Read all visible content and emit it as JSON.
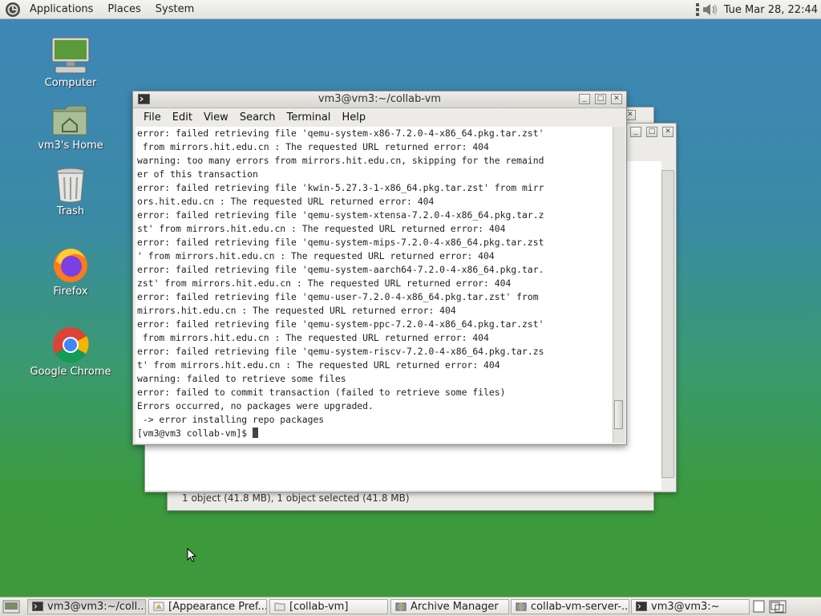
{
  "top_panel": {
    "menus": [
      "Applications",
      "Places",
      "System"
    ],
    "clock": "Tue Mar 28, 22:44"
  },
  "desktop_icons": [
    {
      "label": "Computer",
      "icon": "computer-icon"
    },
    {
      "label": "vm3's Home",
      "icon": "home-folder-icon"
    },
    {
      "label": "Trash",
      "icon": "trash-icon"
    },
    {
      "label": "Firefox",
      "icon": "firefox-icon"
    },
    {
      "label": "Google Chrome",
      "icon": "chrome-icon"
    }
  ],
  "archive_manager": {
    "status": "1 object (41.8 MB), 1 object selected (41.8 MB)"
  },
  "terminal": {
    "title": "vm3@vm3:~/collab-vm",
    "menus": [
      "File",
      "Edit",
      "View",
      "Search",
      "Terminal",
      "Help"
    ],
    "lines": [
      "error: failed retrieving file 'qemu-system-x86-7.2.0-4-x86_64.pkg.tar.zst'",
      " from mirrors.hit.edu.cn : The requested URL returned error: 404",
      "warning: too many errors from mirrors.hit.edu.cn, skipping for the remaind",
      "er of this transaction",
      "error: failed retrieving file 'kwin-5.27.3-1-x86_64.pkg.tar.zst' from mirr",
      "ors.hit.edu.cn : The requested URL returned error: 404",
      "error: failed retrieving file 'qemu-system-xtensa-7.2.0-4-x86_64.pkg.tar.z",
      "st' from mirrors.hit.edu.cn : The requested URL returned error: 404",
      "error: failed retrieving file 'qemu-system-mips-7.2.0-4-x86_64.pkg.tar.zst",
      "' from mirrors.hit.edu.cn : The requested URL returned error: 404",
      "error: failed retrieving file 'qemu-system-aarch64-7.2.0-4-x86_64.pkg.tar.",
      "zst' from mirrors.hit.edu.cn : The requested URL returned error: 404",
      "error: failed retrieving file 'qemu-user-7.2.0-4-x86_64.pkg.tar.zst' from",
      "mirrors.hit.edu.cn : The requested URL returned error: 404",
      "error: failed retrieving file 'qemu-system-ppc-7.2.0-4-x86_64.pkg.tar.zst'",
      " from mirrors.hit.edu.cn : The requested URL returned error: 404",
      "error: failed retrieving file 'qemu-system-riscv-7.2.0-4-x86_64.pkg.tar.zs",
      "t' from mirrors.hit.edu.cn : The requested URL returned error: 404",
      "warning: failed to retrieve some files",
      "error: failed to commit transaction (failed to retrieve some files)",
      "Errors occurred, no packages were upgraded.",
      " -> error installing repo packages",
      "[vm3@vm3 collab-vm]$ "
    ]
  },
  "taskbar": {
    "tasks": [
      {
        "label": "vm3@vm3:~/coll...",
        "icon": "terminal-icon",
        "active": true
      },
      {
        "label": "[Appearance Pref...",
        "icon": "appearance-icon",
        "active": false
      },
      {
        "label": "[collab-vm]",
        "icon": "folder-icon",
        "active": false
      },
      {
        "label": "Archive Manager",
        "icon": "archive-icon",
        "active": false
      },
      {
        "label": "collab-vm-server-...",
        "icon": "archive-icon",
        "active": false
      },
      {
        "label": "vm3@vm3:~",
        "icon": "terminal-icon",
        "active": false
      }
    ]
  }
}
